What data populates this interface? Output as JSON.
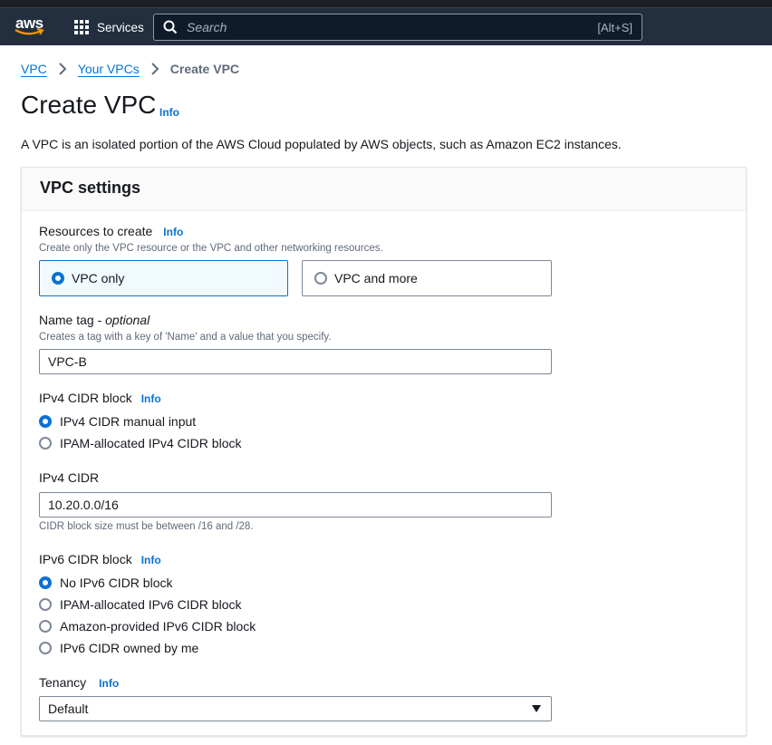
{
  "nav": {
    "logo_text": "aws",
    "services_label": "Services",
    "search_placeholder": "Search",
    "search_shortcut": "[Alt+S]"
  },
  "breadcrumb": {
    "items": [
      "VPC",
      "Your VPCs"
    ],
    "current": "Create VPC"
  },
  "page": {
    "title": "Create VPC",
    "info": "Info",
    "description": "A VPC is an isolated portion of the AWS Cloud populated by AWS objects, such as Amazon EC2 instances."
  },
  "panel": {
    "title": "VPC settings",
    "resources": {
      "label": "Resources to create",
      "info": "Info",
      "hint": "Create only the VPC resource or the VPC and other networking resources.",
      "options": [
        {
          "label": "VPC only",
          "selected": true
        },
        {
          "label": "VPC and more",
          "selected": false
        }
      ]
    },
    "name_tag": {
      "label": "Name tag - ",
      "optional": "optional",
      "hint": "Creates a tag with a key of 'Name' and a value that you specify.",
      "value": "VPC-B"
    },
    "ipv4_block": {
      "label": "IPv4 CIDR block",
      "info": "Info",
      "options": [
        {
          "label": "IPv4 CIDR manual input",
          "selected": true
        },
        {
          "label": "IPAM-allocated IPv4 CIDR block",
          "selected": false
        }
      ]
    },
    "ipv4_cidr": {
      "label": "IPv4 CIDR",
      "value": "10.20.0.0/16",
      "hint": "CIDR block size must be between /16 and /28."
    },
    "ipv6_block": {
      "label": "IPv6 CIDR block",
      "info": "Info",
      "options": [
        {
          "label": "No IPv6 CIDR block",
          "selected": true
        },
        {
          "label": "IPAM-allocated IPv6 CIDR block",
          "selected": false
        },
        {
          "label": "Amazon-provided IPv6 CIDR block",
          "selected": false
        },
        {
          "label": "IPv6 CIDR owned by me",
          "selected": false
        }
      ]
    },
    "tenancy": {
      "label": "Tenancy",
      "info": "Info",
      "value": "Default"
    }
  },
  "colors": {
    "nav_bg": "#232f3e",
    "link": "#0972d3",
    "selected_tile_bg": "#f1faff"
  }
}
